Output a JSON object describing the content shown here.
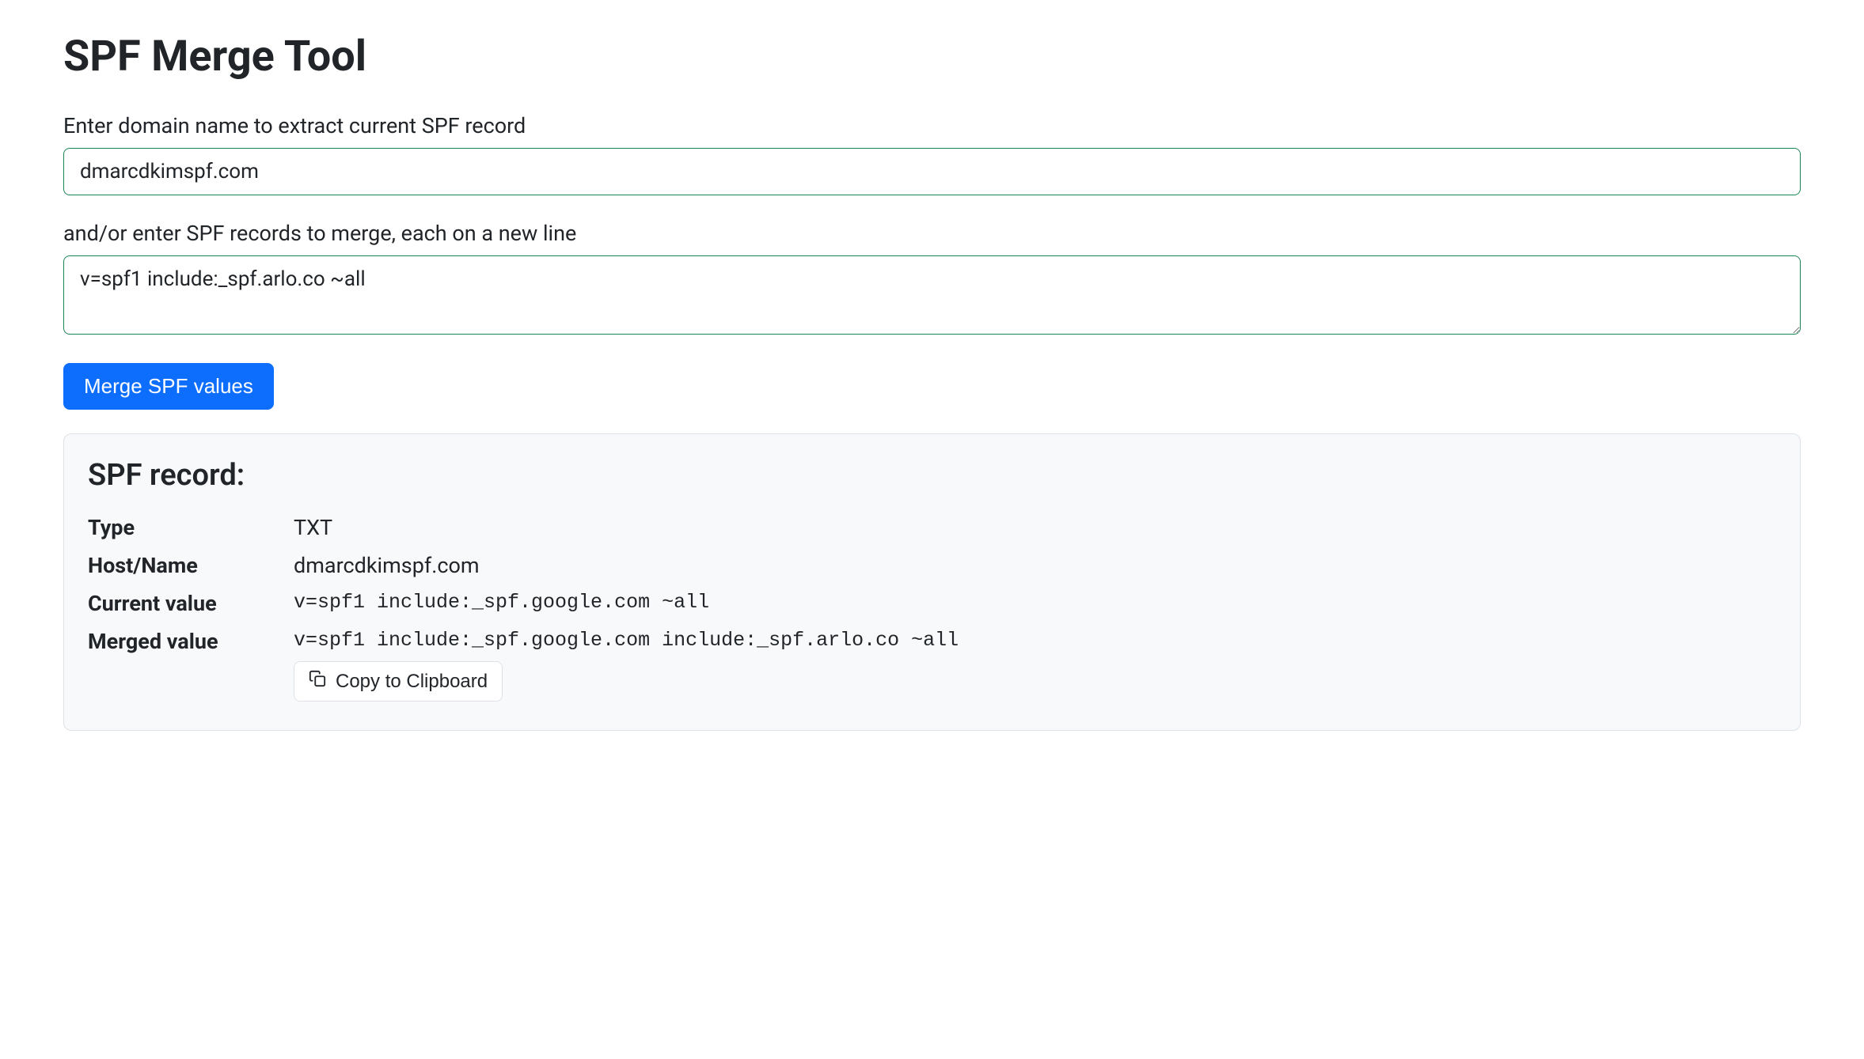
{
  "title": "SPF Merge Tool",
  "form": {
    "domain_label": "Enter domain name to extract current SPF record",
    "domain_value": "dmarcdkimspf.com",
    "records_label": "and/or enter SPF records to merge, each on a new line",
    "records_value": "v=spf1 include:_spf.arlo.co ~all",
    "submit_label": "Merge SPF values"
  },
  "result": {
    "heading": "SPF record:",
    "rows": {
      "type": {
        "label": "Type",
        "value": "TXT"
      },
      "host": {
        "label": "Host/Name",
        "value": "dmarcdkimspf.com"
      },
      "current": {
        "label": "Current value",
        "value": "v=spf1 include:_spf.google.com ~all"
      },
      "merged": {
        "label": "Merged value",
        "value": "v=spf1 include:_spf.google.com include:_spf.arlo.co ~all"
      }
    },
    "copy_label": "Copy to Clipboard"
  }
}
